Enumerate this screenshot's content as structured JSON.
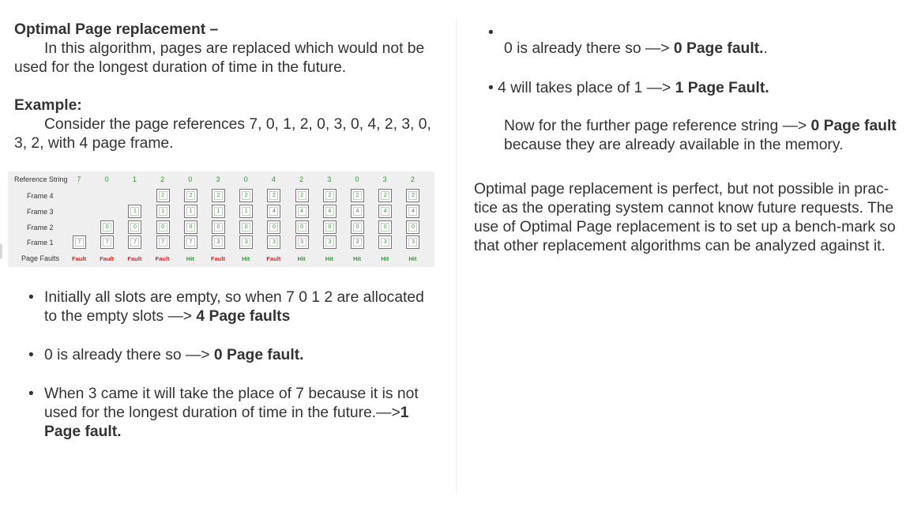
{
  "left": {
    "title": "Optimal Page replacement –",
    "intro": "In this algorithm, pages are replaced which would not be used for the longest duration of time in the future.",
    "example_heading": "Example:",
    "example_text": "Consider the page references 7, 0, 1, 2, 0, 3, 0, 4, 2, 3, 0, 3, 2, with 4 page frame."
  },
  "table": {
    "ref_label": "Reference String",
    "reference": [
      "7",
      "0",
      "1",
      "2",
      "0",
      "3",
      "0",
      "4",
      "2",
      "3",
      "0",
      "3",
      "2"
    ],
    "frame_labels": [
      "Frame 4",
      "Frame 3",
      "Frame 2",
      "Frame 1"
    ],
    "frames": [
      [
        "",
        "",
        "",
        "2",
        "2",
        "2",
        "2",
        "2",
        "2",
        "2",
        "2",
        "2",
        "2"
      ],
      [
        "",
        "",
        "1",
        "1",
        "1",
        "1",
        "1",
        "4",
        "4",
        "4",
        "4",
        "4",
        "4"
      ],
      [
        "",
        "0",
        "0",
        "0",
        "0",
        "0",
        "0",
        "0",
        "0",
        "0",
        "0",
        "0",
        "0"
      ],
      [
        "7",
        "7",
        "7",
        "7",
        "7",
        "3",
        "3",
        "3",
        "3",
        "3",
        "3",
        "3",
        "3"
      ]
    ],
    "faults_label": "Page Faults",
    "results": [
      "Fault",
      "Fault",
      "Fault",
      "Fault",
      "Hit",
      "Fault",
      "Hit",
      "Fault",
      "Hit",
      "Hit",
      "Hit",
      "Hit",
      "Hit"
    ]
  },
  "bullets": {
    "b1_text": "Initially all slots are empty, so when 7 0 1 2 are allocated to the empty slots —> ",
    "b1_bold": "4 Page faults",
    "b2_text": "0 is already there so —> ",
    "b2_bold": "0 Page fault.",
    "b3_text": "When 3 came it will take the place of 7 because it is not used for the longest duration of time in the future.—>",
    "b3_bold": "1 Page fault."
  },
  "right": {
    "r1_text": "0 is already there so —> ",
    "r1_bold": "0 Page fault.",
    "r1_tail": ".",
    "r2_text": "4 will takes place of 1 —> ",
    "r2_bold": "1 Page Fault.",
    "r3_text": "Now for the further page reference string —> ",
    "r3_bold": "0 Page fault",
    "r3_tail": " because they are already available in the memory.",
    "conclusion": "Optimal page replacement is perfect, but not possible in prac-tice as the operating system cannot know future requests. The use of Optimal Page replacement is to set up a bench-mark so that other replacement algorithms can be analyzed against it."
  },
  "bullet_char": "•"
}
